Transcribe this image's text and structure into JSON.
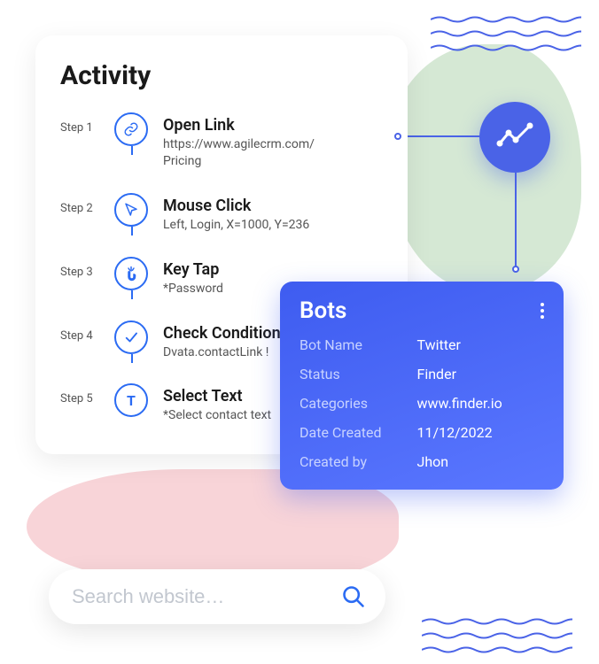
{
  "activity": {
    "title": "Activity",
    "steps": [
      {
        "label": "Step 1",
        "title": "Open Link",
        "sub": "https://www.agilecrm.com/\nPricing",
        "icon": "link"
      },
      {
        "label": "Step 2",
        "title": "Mouse Click",
        "sub": "Left, Login, X=1000, Y=236",
        "icon": "cursor"
      },
      {
        "label": "Step 3",
        "title": "Key Tap",
        "sub": "*Password",
        "icon": "tap"
      },
      {
        "label": "Step 4",
        "title": "Check Condition",
        "sub": "Dvata.contactLink !",
        "icon": "check"
      },
      {
        "label": "Step 5",
        "title": "Select Text",
        "sub": "*Select contact text",
        "icon": "text"
      }
    ]
  },
  "bots": {
    "title": "Bots",
    "rows": [
      {
        "key": "Bot Name",
        "val": "Twitter"
      },
      {
        "key": "Status",
        "val": "Finder"
      },
      {
        "key": "Categories",
        "val": "www.finder.io"
      },
      {
        "key": "Date Created",
        "val": "11/12/2022"
      },
      {
        "key": "Created by",
        "val": "Jhon"
      }
    ]
  },
  "search": {
    "placeholder": "Search website…"
  }
}
